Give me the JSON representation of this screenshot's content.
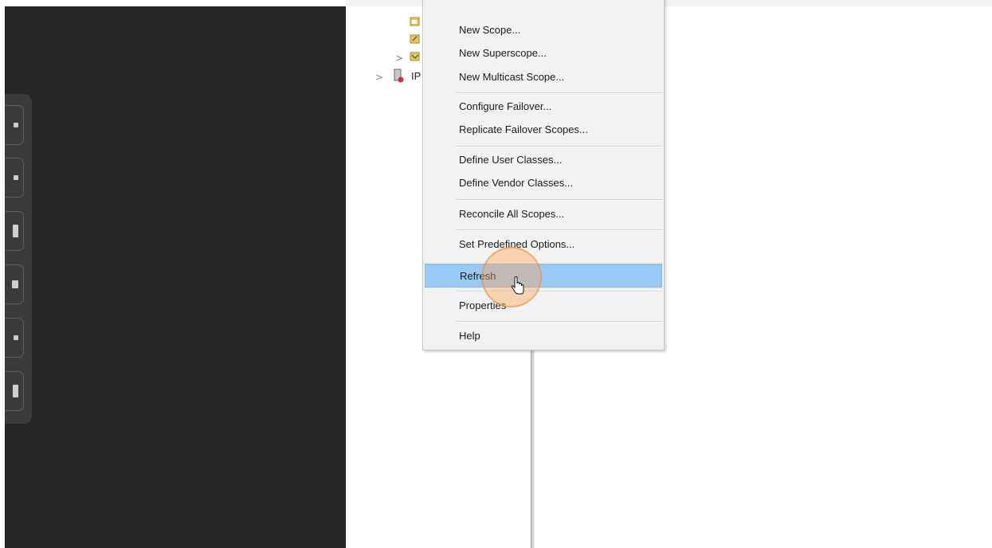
{
  "context_menu": {
    "items": [
      {
        "label": "New Scope..."
      },
      {
        "label": "New Superscope..."
      },
      {
        "label": "New Multicast Scope..."
      },
      {
        "label": "Configure Failover..."
      },
      {
        "label": "Replicate Failover Scopes..."
      },
      {
        "label": "Define User Classes..."
      },
      {
        "label": "Define Vendor Classes..."
      },
      {
        "label": "Reconcile All Scopes..."
      },
      {
        "label": "Set Predefined Options..."
      },
      {
        "label": "Refresh",
        "highlighted": true
      },
      {
        "label": "Properties"
      },
      {
        "label": "Help"
      }
    ]
  },
  "tree": {
    "ipv6_node_label": "IP"
  },
  "toolbar": {
    "buttons": [
      {
        "icon": "toolbar-tool-1-icon"
      },
      {
        "icon": "toolbar-tool-2-icon"
      },
      {
        "icon": "toolbar-tool-3-icon"
      },
      {
        "icon": "toolbar-tool-4-icon"
      },
      {
        "icon": "toolbar-tool-5-icon"
      },
      {
        "icon": "toolbar-tool-6-icon"
      }
    ]
  },
  "colors": {
    "highlight": "#99c9f5",
    "click_indicator": "#f5a050",
    "dark_panel": "#262626"
  }
}
